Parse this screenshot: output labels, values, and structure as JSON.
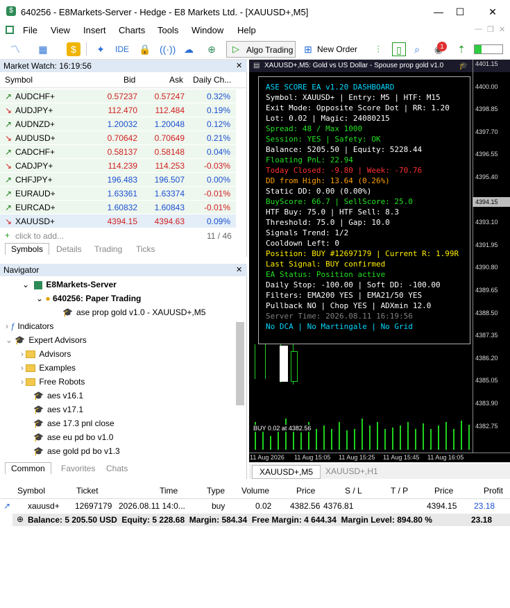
{
  "window": {
    "title": "640256 - E8Markets-Server - Hedge - E8 Markets Ltd. - [XAUUSD+,M5]",
    "min": "—",
    "max": "☐",
    "close": "✕"
  },
  "menu": [
    "File",
    "View",
    "Insert",
    "Charts",
    "Tools",
    "Window",
    "Help"
  ],
  "toolbar": {
    "ide": "IDE",
    "algo": "Algo Trading",
    "new_order": "New Order",
    "badge": "1"
  },
  "market_watch": {
    "title": "Market Watch: 16:19:56",
    "headers": {
      "symbol": "Symbol",
      "bid": "Bid",
      "ask": "Ask",
      "change": "Daily Ch..."
    },
    "rows": [
      {
        "symbol": "AUDCHF+",
        "bid": "0.57237",
        "ask": "0.57247",
        "change": "0.32%",
        "dir": "up",
        "cb": "red",
        "ca": "red",
        "cc": "blue"
      },
      {
        "symbol": "AUDJPY+",
        "bid": "112.470",
        "ask": "112.484",
        "change": "0.19%",
        "dir": "down",
        "cb": "red",
        "ca": "red",
        "cc": "blue"
      },
      {
        "symbol": "AUDNZD+",
        "bid": "1.20032",
        "ask": "1.20048",
        "change": "0.12%",
        "dir": "up",
        "cb": "blue",
        "ca": "blue",
        "cc": "blue"
      },
      {
        "symbol": "AUDUSD+",
        "bid": "0.70642",
        "ask": "0.70649",
        "change": "0.21%",
        "dir": "down",
        "cb": "red",
        "ca": "red",
        "cc": "blue"
      },
      {
        "symbol": "CADCHF+",
        "bid": "0.58137",
        "ask": "0.58148",
        "change": "0.04%",
        "dir": "up",
        "cb": "red",
        "ca": "red",
        "cc": "blue"
      },
      {
        "symbol": "CADJPY+",
        "bid": "114.239",
        "ask": "114.253",
        "change": "-0.03%",
        "dir": "down",
        "cb": "red",
        "ca": "red",
        "cc": "red"
      },
      {
        "symbol": "CHFJPY+",
        "bid": "196.483",
        "ask": "196.507",
        "change": "0.00%",
        "dir": "up",
        "cb": "blue",
        "ca": "blue",
        "cc": "blue"
      },
      {
        "symbol": "EURAUD+",
        "bid": "1.63361",
        "ask": "1.63374",
        "change": "-0.01%",
        "dir": "up",
        "cb": "blue",
        "ca": "blue",
        "cc": "red"
      },
      {
        "symbol": "EURCAD+",
        "bid": "1.60832",
        "ask": "1.60843",
        "change": "-0.01%",
        "dir": "up",
        "cb": "blue",
        "ca": "blue",
        "cc": "red"
      },
      {
        "symbol": "XAUUSD+",
        "bid": "4394.15",
        "ask": "4394.63",
        "change": "0.09%",
        "dir": "down",
        "cb": "red",
        "ca": "red",
        "cc": "blue"
      }
    ],
    "add": "click to add...",
    "count": "11 / 46",
    "tabs": [
      "Symbols",
      "Details",
      "Trading",
      "Ticks"
    ]
  },
  "navigator": {
    "title": "Navigator",
    "server": "E8Markets-Server",
    "account": "640256: Paper Trading",
    "ea": "ase prop gold v1.0 - XAUUSD+,M5",
    "indicators": "Indicators",
    "experts": "Expert Advisors",
    "folders": [
      "Advisors",
      "Examples",
      "Free Robots"
    ],
    "items": [
      "aes v16.1",
      "aes v17.1",
      "ase 17.3 pnl close",
      "ase eu pd bo v1.0",
      "ase gold pd bo v1.3"
    ],
    "tabs": [
      "Common",
      "Favorites",
      "Chats"
    ]
  },
  "chart": {
    "header": "XAUUSD+,M5: Gold vs US Dollar - Spouse prop gold v1.0",
    "prices": [
      "4401.15",
      "4400.00",
      "4398.85",
      "4397.70",
      "4396.55",
      "4395.40",
      "4394.15",
      "4393.10",
      "4391.95",
      "4390.80",
      "4389.65",
      "4388.50",
      "4387.35",
      "4386.20",
      "4385.05",
      "4383.90",
      "4382.75"
    ],
    "times": [
      "11 Aug 2026",
      "11 Aug 15:05",
      "11 Aug 15:25",
      "11 Aug 15:45",
      "11 Aug 16:05"
    ],
    "buy_label": "BUY 0.02 at 4382.56",
    "tabs": [
      "XAUUSD+,M5",
      "XAUUSD+,H1"
    ]
  },
  "dashboard": [
    {
      "text": "ASE SCORE EA v1.20 DASHBOARD",
      "color": "#00d8ff"
    },
    {
      "text": "Symbol: XAUUSD+ | Entry: M5 | HTF: M15",
      "color": "#ffffff"
    },
    {
      "text": "Exit Mode: Opposite Score Dot | RR: 1.20",
      "color": "#ffffff"
    },
    {
      "text": "Lot: 0.02 | Magic: 24080215",
      "color": "#ffffff"
    },
    {
      "text": "Spread: 48 / Max 1000",
      "color": "#22e022"
    },
    {
      "text": "Session: YES | Safety: OK",
      "color": "#22e022"
    },
    {
      "text": "Balance: 5205.50 | Equity: 5228.44",
      "color": "#ffffff"
    },
    {
      "text": "Floating PnL: 22.94",
      "color": "#22e022"
    },
    {
      "text": "Today Closed: -9.80 | Week: -70.76",
      "color": "#ff3030"
    },
    {
      "text": "DD from High: 13.64 (0.26%)",
      "color": "#ffa000"
    },
    {
      "text": "Static DD: 0.00 (0.00%)",
      "color": "#ffffff"
    },
    {
      "text": "BuyScore: 66.7 | SellScore: 25.0",
      "color": "#22e022"
    },
    {
      "text": "HTF Buy: 75.0 | HTF Sell: 8.3",
      "color": "#ffffff"
    },
    {
      "text": "Threshold: 75.0 | Gap: 10.0",
      "color": "#ffffff"
    },
    {
      "text": "Signals Trend: 1/2",
      "color": "#ffffff"
    },
    {
      "text": "Cooldown Left: 0",
      "color": "#ffffff"
    },
    {
      "text": "Position: BUY #12697179 | Current R: 1.99R",
      "color": "#ffee00"
    },
    {
      "text": "Last Signal: BUY confirmed",
      "color": "#ffee00"
    },
    {
      "text": "EA Status: Position active",
      "color": "#22e022"
    },
    {
      "text": "Daily Stop: -100.00 | Soft DD: -100.00",
      "color": "#ffffff"
    },
    {
      "text": "Filters: EMA200 YES | EMA21/50 YES",
      "color": "#ffffff"
    },
    {
      "text": "Pullback NO | Chop YES | ADXmin 12.0",
      "color": "#ffffff"
    },
    {
      "text": "Server Time: 2026.08.11 16:19:56",
      "color": "#808080"
    },
    {
      "text": "No DCA | No Martingale | No Grid",
      "color": "#00d8ff"
    }
  ],
  "terminal": {
    "headers": [
      "Symbol",
      "Ticket",
      "Time",
      "Type",
      "Volume",
      "Price",
      "S / L",
      "T / P",
      "Price",
      "Profit"
    ],
    "row": [
      "xauusd+",
      "12697179",
      "2026.08.11 14:0...",
      "buy",
      "0.02",
      "4382.56",
      "4376.81",
      "",
      "4394.15",
      "23.18"
    ],
    "summary": "Balance: 5 205.50 USD  Equity: 5 228.68  Margin: 584.34  Free Margin: 4 644.34  Margin Level: 894.80 %",
    "total": "23.18"
  }
}
